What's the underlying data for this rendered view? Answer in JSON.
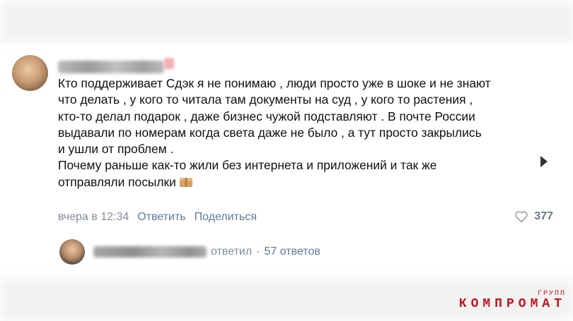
{
  "comment": {
    "text": "Кто поддерживает Сдэк я не понимаю , люди просто уже в шоке и не знают\nчто делать , у кого то читала там документы на суд , у кого то растения ,\nкто-то делал подарок , даже бизнес чужой подставляют . В почте России\nвыдавали по номерам когда света даже не было , а тут просто закрылись\nи ушли от проблем .\nПочему раньше как-то жили без интернета и приложений и так же\nотправляли посылки",
    "emoji_icon": "parcel-icon",
    "timestamp": "вчера в 12:34",
    "reply_label": "Ответить",
    "share_label": "Поделиться",
    "likes": "377"
  },
  "reply_thread": {
    "replied_label": "ответил",
    "separator": "·",
    "count_label": "57 ответов"
  },
  "watermark": {
    "small": "ГРУПП",
    "main": "КОМПРОМАТ"
  },
  "colors": {
    "link": "#5e7a99",
    "meta": "#818c99",
    "watermark": "#c0141c"
  }
}
